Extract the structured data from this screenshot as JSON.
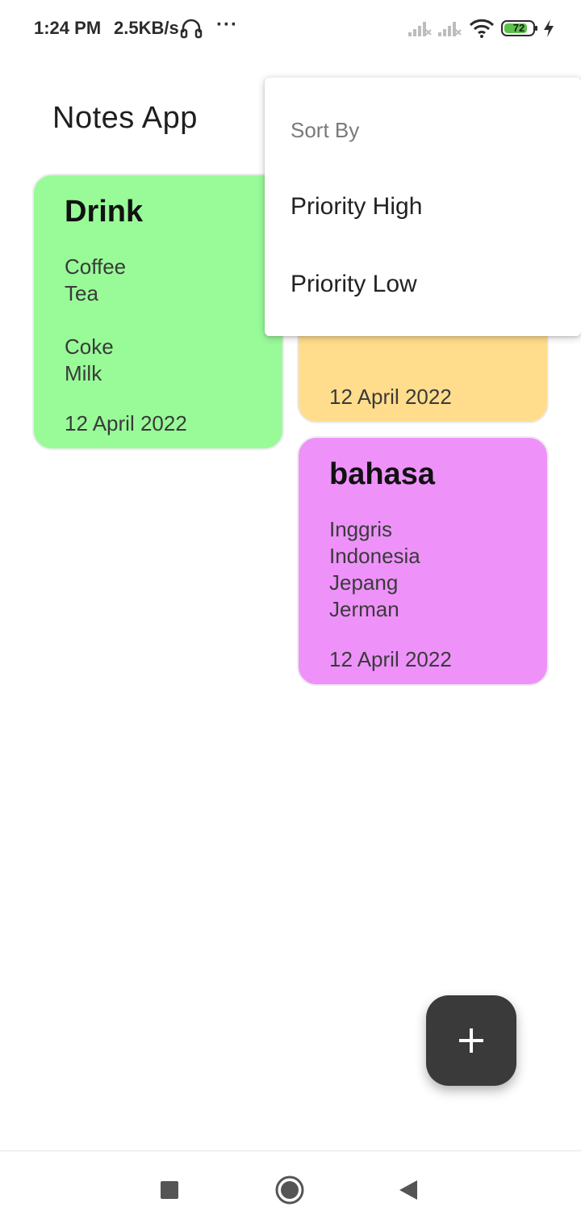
{
  "status_bar": {
    "time": "1:24 PM",
    "network_speed": "2.5KB/s",
    "more": "···",
    "battery_level": "72",
    "icons": [
      "headset-icon",
      "signal-icon",
      "signal-icon",
      "wifi-icon",
      "battery-icon",
      "charging-icon"
    ]
  },
  "app": {
    "title": "Notes App"
  },
  "notes": [
    {
      "title": "Drink",
      "body": "Coffee\nTea\n\nCoke\nMilk",
      "date": "12 April 2022",
      "color": "#98FB98"
    },
    {
      "title": "",
      "body": "",
      "date": "12 April 2022",
      "color": "#FFDD8C"
    },
    {
      "title": "bahasa",
      "body": "Inggris\nIndonesia\nJepang\nJerman",
      "date": "12 April 2022",
      "color": "#EE92FA"
    }
  ],
  "sort_menu": {
    "header": "Sort By",
    "items": [
      "Priority High",
      "Priority Low"
    ]
  },
  "fab": {
    "icon": "add-icon"
  },
  "nav_bar": {
    "icons": [
      "recents-icon",
      "home-icon",
      "back-icon"
    ]
  },
  "colors": {
    "fab_background": "#3A3A3A",
    "menu_background": "#FFFFFF"
  }
}
